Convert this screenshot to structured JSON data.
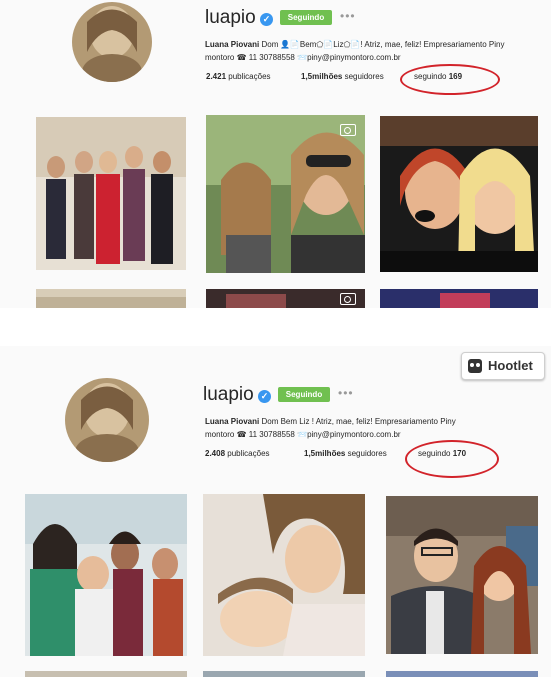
{
  "screenshots": [
    {
      "username": "luapio",
      "follow_label": "Seguindo",
      "more_label": "•••",
      "bio_name": "Luana Piovani",
      "bio_text_1": "Dom⁠ 👤📄Bem⬠📄Liz⬠📄! Atriz, mae, feliz! Empresariamento Piny",
      "bio_text_2": "montoro ☎ 11 30788558 📨piny@pinymontoro.com.br",
      "posts_count": "2.421",
      "posts_label": "publicações",
      "followers_count": "1,5milhões",
      "followers_label": "seguidores",
      "following_label": "seguindo",
      "following_count": "169"
    },
    {
      "username": "luapio",
      "follow_label": "Seguindo",
      "more_label": "•••",
      "bio_name": "Luana Piovani",
      "bio_text_1": "Dom    Bem    Liz    ! Atriz, mae, feliz! Empresariamento Piny",
      "bio_text_2": "montoro ☎ 11 30788558 📨piny@pinymontoro.com.br",
      "posts_count": "2.408",
      "posts_label": "publicações",
      "followers_count": "1,5milhões",
      "followers_label": "seguidores",
      "following_label": "seguindo",
      "following_count": "170",
      "hootlet_label": "Hootlet"
    }
  ],
  "colors": {
    "follow_green": "#70c050",
    "verified_blue": "#3897f0",
    "highlight_red": "#d2232a"
  }
}
